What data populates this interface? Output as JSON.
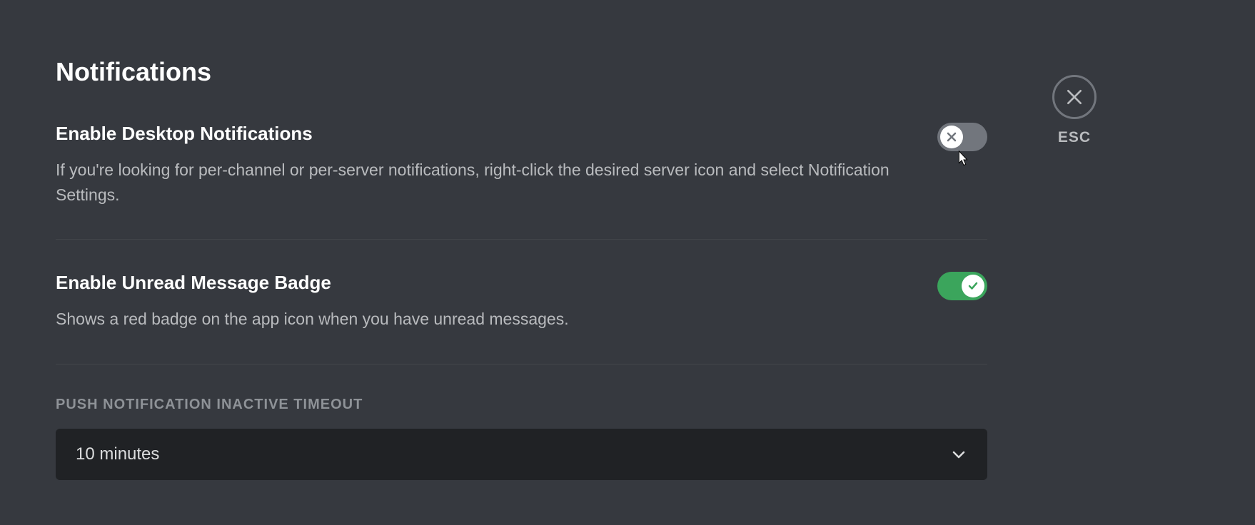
{
  "page": {
    "title": "Notifications"
  },
  "close": {
    "label": "ESC"
  },
  "settings": {
    "desktopNotifications": {
      "title": "Enable Desktop Notifications",
      "description": "If you're looking for per-channel or per-server notifications, right-click the desired server icon and select Notification Settings.",
      "enabled": false
    },
    "unreadBadge": {
      "title": "Enable Unread Message Badge",
      "description": "Shows a red badge on the app icon when you have unread messages.",
      "enabled": true
    }
  },
  "pushTimeout": {
    "label": "PUSH NOTIFICATION INACTIVE TIMEOUT",
    "value": "10 minutes"
  }
}
